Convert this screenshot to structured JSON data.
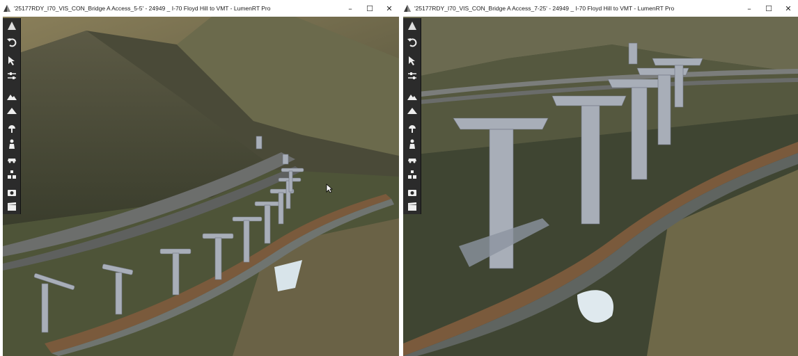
{
  "windows": [
    {
      "title": "'25177RDY_I70_VIS_CON_Bridge A Access_5-5' - 24949 _ I-70 Floyd Hill to VMT - LumenRT Pro",
      "controls": {
        "minimize": "–",
        "maximize": "☐",
        "close": "✕"
      }
    },
    {
      "title": "'25177RDY_I70_VIS_CON_Bridge A Access_7-25' - 24949 _ I-70 Floyd Hill to VMT - LumenRT Pro",
      "controls": {
        "minimize": "–",
        "maximize": "☐",
        "close": "✕"
      }
    }
  ],
  "toolbar": {
    "tools": [
      "logo-icon",
      "undo-icon",
      "select-arrow-icon",
      "adjust-icon",
      "terrain-sculpt-icon",
      "terrain-icon",
      "light-icon",
      "character-icon",
      "vehicle-icon",
      "objects-icon",
      "camera-icon",
      "clapperboard-icon"
    ]
  },
  "colors": {
    "toolbar_bg": "#2b2b2b",
    "road": "#7a5a3c",
    "pier": "#9aa0ac",
    "terrain_dark": "#3d4230",
    "terrain_light": "#8a8560"
  }
}
